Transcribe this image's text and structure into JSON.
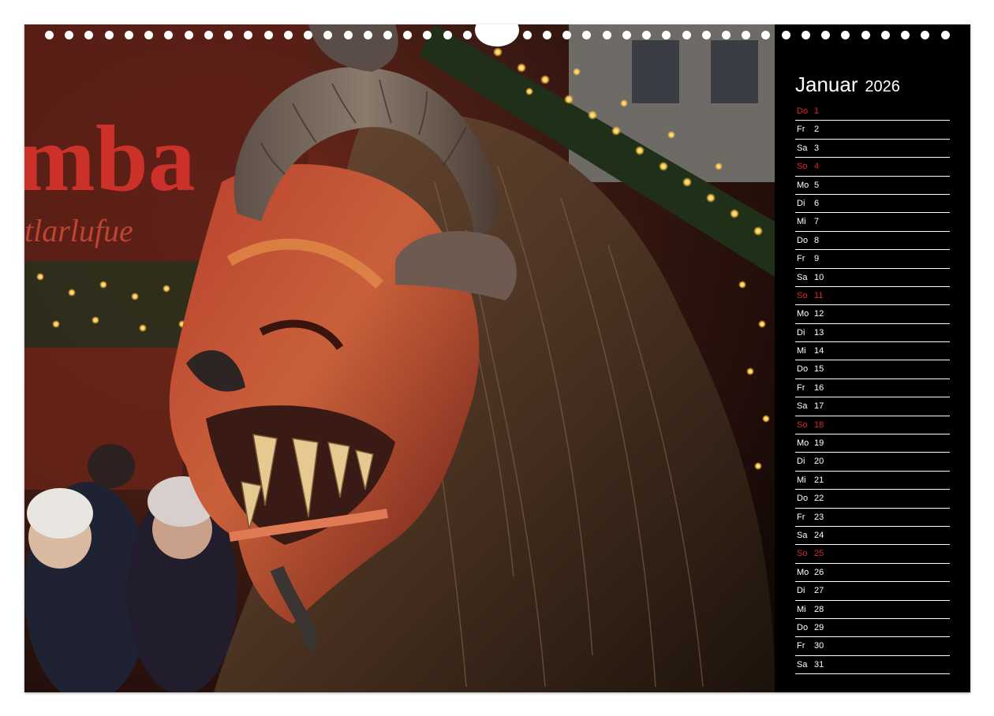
{
  "calendar": {
    "month": "Januar",
    "year": "2026",
    "days": [
      {
        "weekday": "Do",
        "day": "1",
        "sunday": true
      },
      {
        "weekday": "Fr",
        "day": "2",
        "sunday": false
      },
      {
        "weekday": "Sa",
        "day": "3",
        "sunday": false
      },
      {
        "weekday": "So",
        "day": "4",
        "sunday": true
      },
      {
        "weekday": "Mo",
        "day": "5",
        "sunday": false
      },
      {
        "weekday": "Di",
        "day": "6",
        "sunday": false
      },
      {
        "weekday": "Mi",
        "day": "7",
        "sunday": false
      },
      {
        "weekday": "Do",
        "day": "8",
        "sunday": false
      },
      {
        "weekday": "Fr",
        "day": "9",
        "sunday": false
      },
      {
        "weekday": "Sa",
        "day": "10",
        "sunday": false
      },
      {
        "weekday": "So",
        "day": "11",
        "sunday": true
      },
      {
        "weekday": "Mo",
        "day": "12",
        "sunday": false
      },
      {
        "weekday": "Di",
        "day": "13",
        "sunday": false
      },
      {
        "weekday": "Mi",
        "day": "14",
        "sunday": false
      },
      {
        "weekday": "Do",
        "day": "15",
        "sunday": false
      },
      {
        "weekday": "Fr",
        "day": "16",
        "sunday": false
      },
      {
        "weekday": "Sa",
        "day": "17",
        "sunday": false
      },
      {
        "weekday": "So",
        "day": "18",
        "sunday": true
      },
      {
        "weekday": "Mo",
        "day": "19",
        "sunday": false
      },
      {
        "weekday": "Di",
        "day": "20",
        "sunday": false
      },
      {
        "weekday": "Mi",
        "day": "21",
        "sunday": false
      },
      {
        "weekday": "Do",
        "day": "22",
        "sunday": false
      },
      {
        "weekday": "Fr",
        "day": "23",
        "sunday": false
      },
      {
        "weekday": "Sa",
        "day": "24",
        "sunday": false
      },
      {
        "weekday": "So",
        "day": "25",
        "sunday": true
      },
      {
        "weekday": "Mo",
        "day": "26",
        "sunday": false
      },
      {
        "weekday": "Di",
        "day": "27",
        "sunday": false
      },
      {
        "weekday": "Mi",
        "day": "28",
        "sunday": false
      },
      {
        "weekday": "Do",
        "day": "29",
        "sunday": false
      },
      {
        "weekday": "Fr",
        "day": "30",
        "sunday": false
      },
      {
        "weekday": "Sa",
        "day": "31",
        "sunday": false
      }
    ]
  },
  "photo": {
    "background_sign": "mba",
    "background_sign_small": "tlarlufue"
  },
  "colors": {
    "panel_background": "#000000",
    "text": "#ffffff",
    "holiday": "#e0262b",
    "sign_red": "#d8342a",
    "light_warm": "#ffc648",
    "mask_red": "#c0302a",
    "fur_brown": "#5a3f2c"
  }
}
